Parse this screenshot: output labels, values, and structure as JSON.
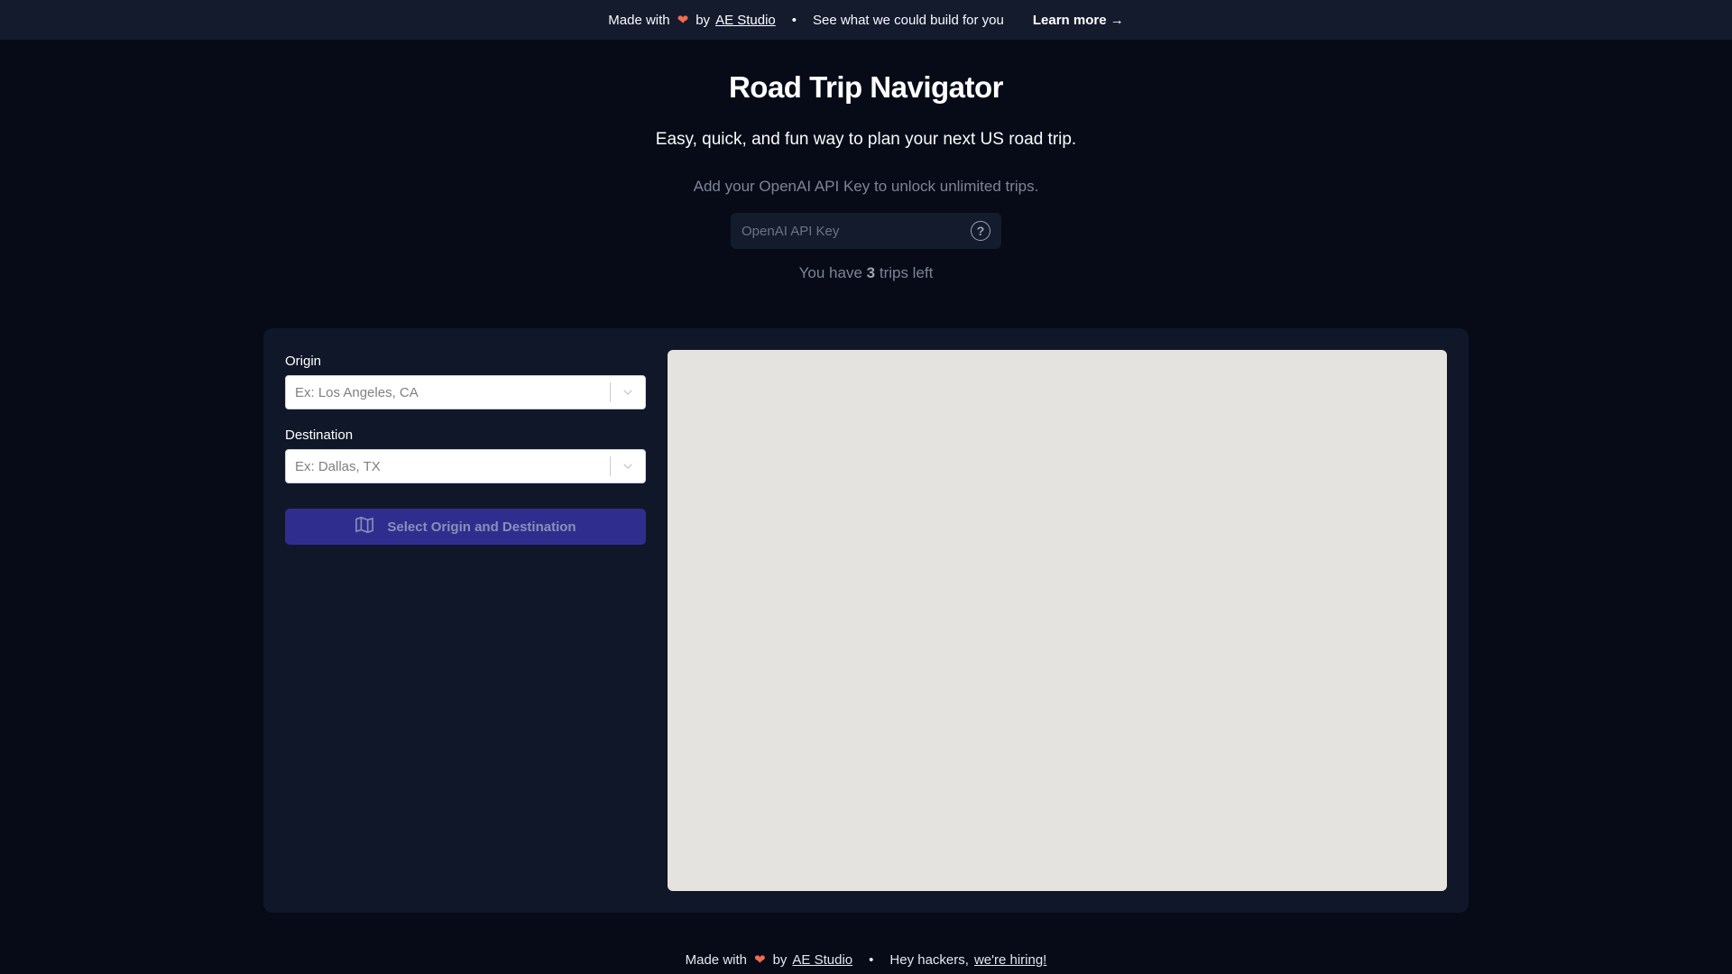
{
  "topbar": {
    "made_with": "Made with",
    "heart": "❤",
    "by": "by",
    "brand_link": "AE Studio",
    "separator": "•",
    "pitch": "See what we could build for you",
    "learn_more": "Learn more →"
  },
  "header": {
    "title": "Road Trip Navigator",
    "subtitle": "Easy, quick, and fun way to plan your next US road trip."
  },
  "api": {
    "note": "Add your OpenAI API Key to unlock unlimited trips.",
    "placeholder": "OpenAI API Key",
    "value": ""
  },
  "trips": {
    "prefix": "You have",
    "count": "3",
    "suffix": "trips left"
  },
  "form": {
    "origin_label": "Origin",
    "origin_placeholder": "Ex: Los Angeles, CA",
    "destination_label": "Destination",
    "destination_placeholder": "Ex: Dallas, TX",
    "submit_label": "Select Origin and Destination"
  },
  "footer": {
    "made_with": "Made with",
    "heart": "❤",
    "by": "by",
    "brand_link": "AE Studio",
    "separator": "•",
    "hackers": "Hey hackers,",
    "hiring_link": "we're hiring!"
  },
  "colors": {
    "background": "#070b17",
    "panel": "#101729",
    "topbar": "#141b2d",
    "accent_button": "#2f2e8f",
    "map_background": "#e5e3df",
    "heart": "#f26b4f"
  },
  "icons": {
    "help": "question-circle-icon",
    "chevron": "chevron-down-icon",
    "map": "map-icon"
  }
}
